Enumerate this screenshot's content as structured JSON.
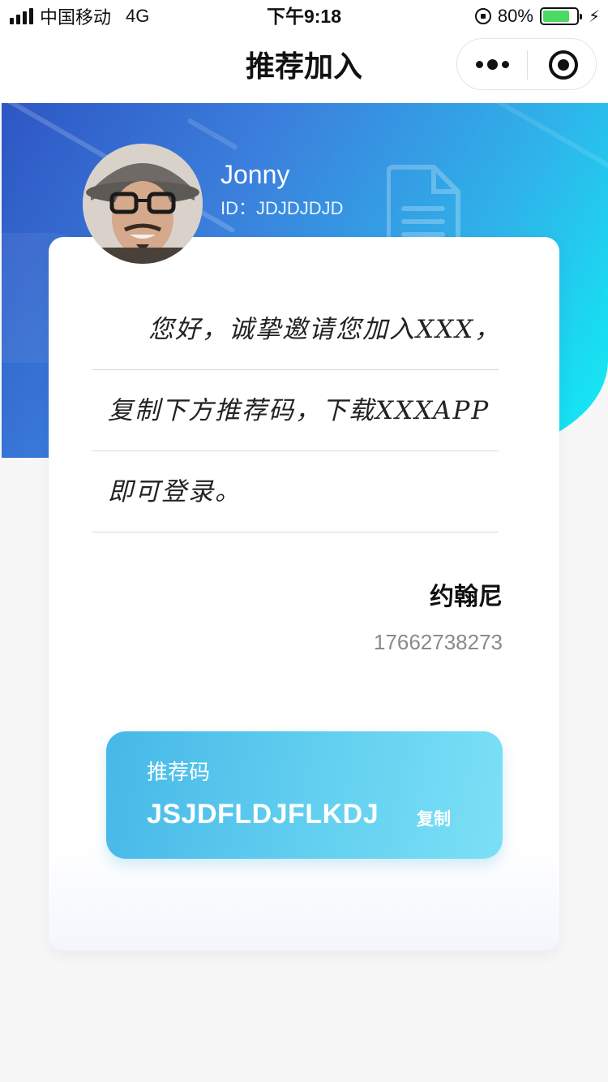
{
  "status_bar": {
    "carrier": "中国移动",
    "network": "4G",
    "time": "下午9:18",
    "battery_level": "80%",
    "battery_fraction": 0.8,
    "icons": [
      "signal-icon",
      "orientation-lock-icon",
      "battery-icon",
      "charging-bolt-icon"
    ]
  },
  "nav": {
    "title": "推荐加入",
    "icons": [
      "more-icon",
      "close-mini-program-icon"
    ]
  },
  "profile": {
    "name": "Jonny",
    "id_text": "ID：JDJDJDJD"
  },
  "letter": {
    "lines": [
      "您好，诚挚邀请您加入XXX，",
      "复制下方推荐码，下载XXXAPP",
      "即可登录。"
    ],
    "signer_name": "约翰尼",
    "signer_phone": "17662738273"
  },
  "referral": {
    "label": "推荐码",
    "code": "JSJDFLDJFLKDJ",
    "copy_label": "复制"
  },
  "colors": {
    "banner_start": "#2e56c4",
    "banner_end": "#0ff0f5",
    "code_box": "#5ccbef",
    "battery_fill": "#4cd964"
  }
}
